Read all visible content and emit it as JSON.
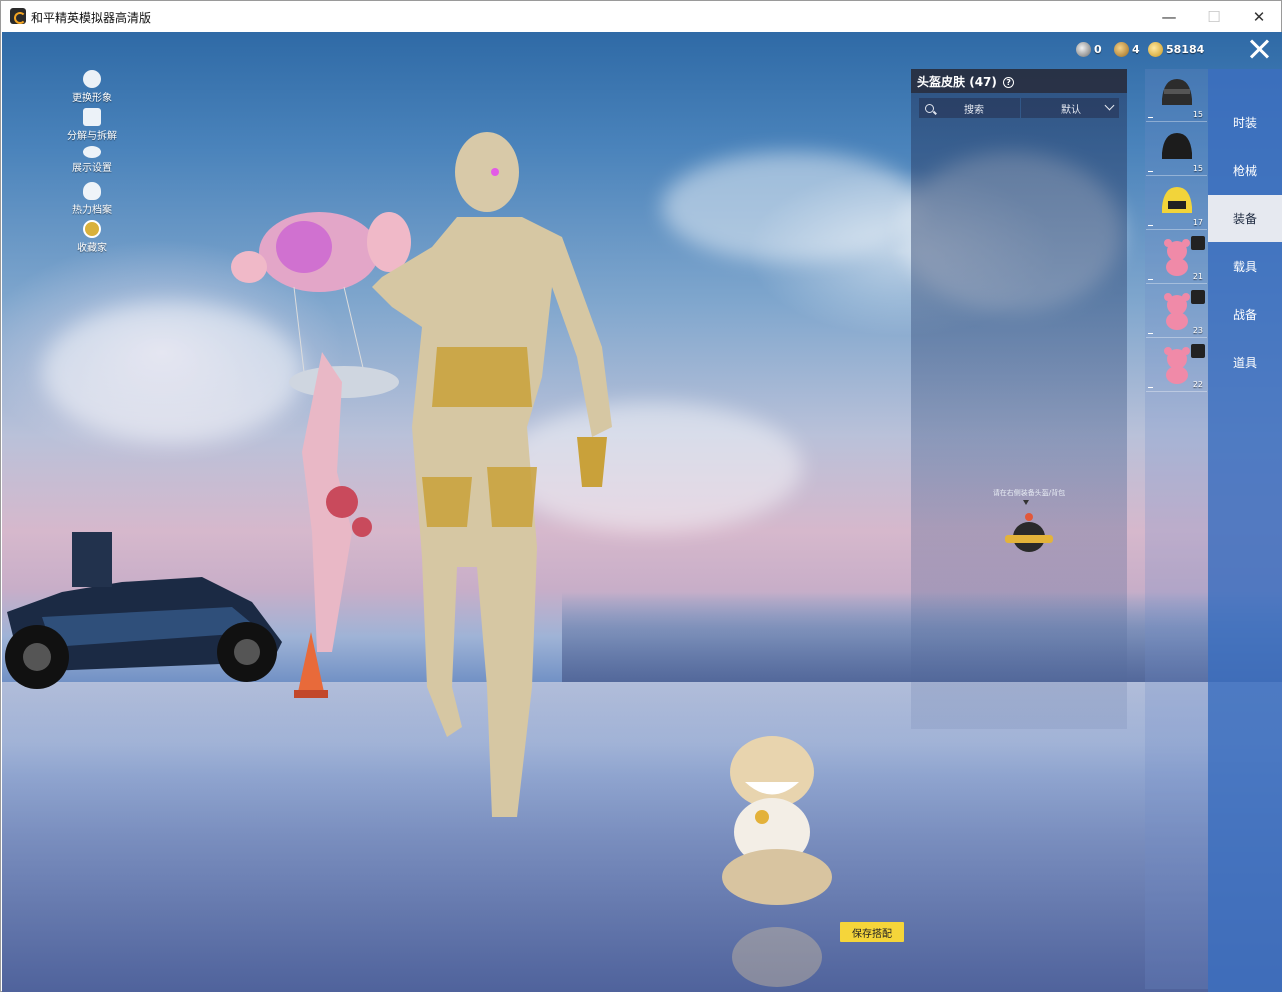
{
  "window": {
    "title": "和平精英模拟器高清版",
    "min_glyph": "—",
    "max_glyph": "☐",
    "close_glyph": "✕"
  },
  "left_menu": [
    {
      "label": "更换形象",
      "icon": "person-icon"
    },
    {
      "label": "分解与拆解",
      "icon": "puzzle-icon"
    },
    {
      "label": "展示设置",
      "icon": "eye-icon"
    },
    {
      "label": "热力档案",
      "icon": "flame-icon"
    },
    {
      "label": "收藏家",
      "icon": "collector-badge-icon"
    }
  ],
  "currencies": [
    {
      "value": "0",
      "icon": "silver-coin-icon",
      "color": "#b8b8b8"
    },
    {
      "value": "4",
      "icon": "bronze-coin-icon",
      "color": "#d8a441"
    },
    {
      "value": "58184",
      "icon": "gold-coin-icon",
      "color": "#f0c43a"
    }
  ],
  "skin_panel": {
    "title": "头盔皮肤",
    "count": "(47)",
    "search_label": "搜索",
    "sort_label": "默认",
    "hint": "请在右侧装备头盔/背包"
  },
  "items": [
    {
      "name": "helmet-black-1",
      "count": "15"
    },
    {
      "name": "helmet-black-2",
      "count": "15"
    },
    {
      "name": "helmet-yellow",
      "count": "17"
    },
    {
      "name": "pink-bear-1",
      "count": "21"
    },
    {
      "name": "pink-bear-2",
      "count": "23"
    },
    {
      "name": "pink-bear-3",
      "count": "22"
    }
  ],
  "categories": [
    {
      "label": "时装",
      "active": false
    },
    {
      "label": "枪械",
      "active": false
    },
    {
      "label": "装备",
      "active": true
    },
    {
      "label": "载具",
      "active": false
    },
    {
      "label": "战备",
      "active": false
    },
    {
      "label": "道具",
      "active": false
    }
  ],
  "save_button": "保存搭配",
  "colors": {
    "nav_blue": "#3c6ebe",
    "active_tab": "#e6e9f0",
    "save_yellow": "#f5d53a"
  }
}
